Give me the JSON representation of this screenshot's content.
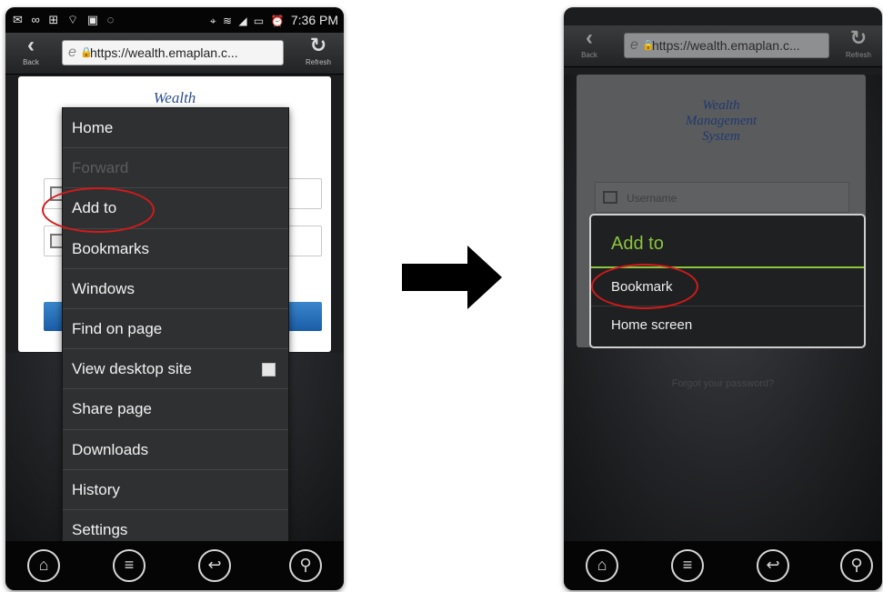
{
  "left_phone": {
    "status_bar": {
      "left_icons": "✉ ∞ ⊞ ⌔ ▣ ◌",
      "right_icons": "⌖ ≋ ◢ ▭ ⏰",
      "time": "7:36 PM"
    },
    "toolbar": {
      "back_label": "Back",
      "url": "https://wealth.emaplan.c...",
      "refresh_label": "Refresh"
    },
    "page": {
      "brand": "Wealth"
    },
    "menu": {
      "items": [
        {
          "label": "Home",
          "enabled": true
        },
        {
          "label": "Forward",
          "enabled": false
        },
        {
          "label": "Add to",
          "enabled": true,
          "highlighted": true
        },
        {
          "label": "Bookmarks",
          "enabled": true
        },
        {
          "label": "Windows",
          "enabled": true
        },
        {
          "label": "Find on page",
          "enabled": true
        },
        {
          "label": "View desktop site",
          "enabled": true,
          "checkbox": true
        },
        {
          "label": "Share page",
          "enabled": true
        },
        {
          "label": "Downloads",
          "enabled": true
        },
        {
          "label": "History",
          "enabled": true
        },
        {
          "label": "Settings",
          "enabled": true
        }
      ]
    }
  },
  "right_phone": {
    "toolbar": {
      "back_label": "Back",
      "url": "https://wealth.emaplan.c...",
      "refresh_label": "Refresh"
    },
    "page": {
      "brand_line1": "Wealth",
      "brand_line2": "Management",
      "brand_line3": "System",
      "username_placeholder": "Username",
      "forgot_text": "Forgot your password?"
    },
    "dialog": {
      "title": "Add to",
      "options": [
        {
          "label": "Bookmark",
          "highlighted": true
        },
        {
          "label": "Home screen"
        }
      ]
    }
  },
  "icons": {
    "home": "home-icon",
    "menu": "menu-icon",
    "back": "back-icon",
    "search": "search-icon",
    "refresh": "refresh-icon",
    "lock": "lock-icon",
    "arrow": "right-arrow-icon"
  },
  "colors": {
    "highlight_ring": "#d21a1a",
    "dialog_accent": "#8bc53f",
    "brand_text": "#2c4d8f"
  }
}
